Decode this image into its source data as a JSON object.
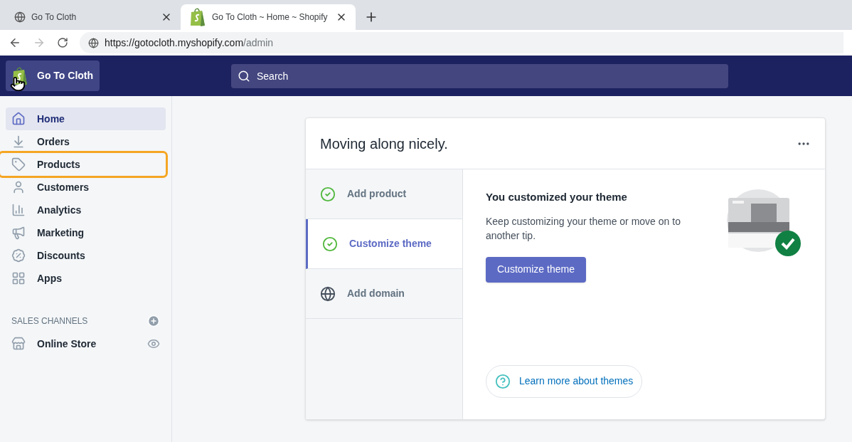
{
  "browser": {
    "tabs": [
      {
        "title": "Go To Cloth",
        "selected": false
      },
      {
        "title": "Go To Cloth ~ Home ~ Shopify",
        "selected": true
      }
    ],
    "url": {
      "host": "https://gotocloth.myshopify.com",
      "path": "/admin"
    }
  },
  "topbar": {
    "store_name": "Go To Cloth",
    "search": {
      "placeholder": "Search"
    }
  },
  "sidebar": {
    "items": [
      {
        "label": "Home",
        "selected": true,
        "highlighted": false
      },
      {
        "label": "Orders",
        "selected": false,
        "highlighted": false
      },
      {
        "label": "Products",
        "selected": false,
        "highlighted": true
      },
      {
        "label": "Customers",
        "selected": false,
        "highlighted": false
      },
      {
        "label": "Analytics",
        "selected": false,
        "highlighted": false
      },
      {
        "label": "Marketing",
        "selected": false,
        "highlighted": false
      },
      {
        "label": "Discounts",
        "selected": false,
        "highlighted": false
      },
      {
        "label": "Apps",
        "selected": false,
        "highlighted": false
      }
    ],
    "sales_channels": {
      "heading": "SALES CHANNELS",
      "items": [
        {
          "label": "Online Store"
        }
      ]
    }
  },
  "card": {
    "title": "Moving along nicely.",
    "tasks": [
      {
        "label": "Add product",
        "kind": "done",
        "selected": false
      },
      {
        "label": "Customize theme",
        "kind": "done",
        "selected": true
      },
      {
        "label": "Add domain",
        "kind": "pending",
        "selected": false
      }
    ],
    "detail": {
      "heading": "You customized your theme",
      "body": "Keep customizing your theme or move on to another tip.",
      "button": "Customize theme",
      "link": "Learn more about themes"
    }
  }
}
